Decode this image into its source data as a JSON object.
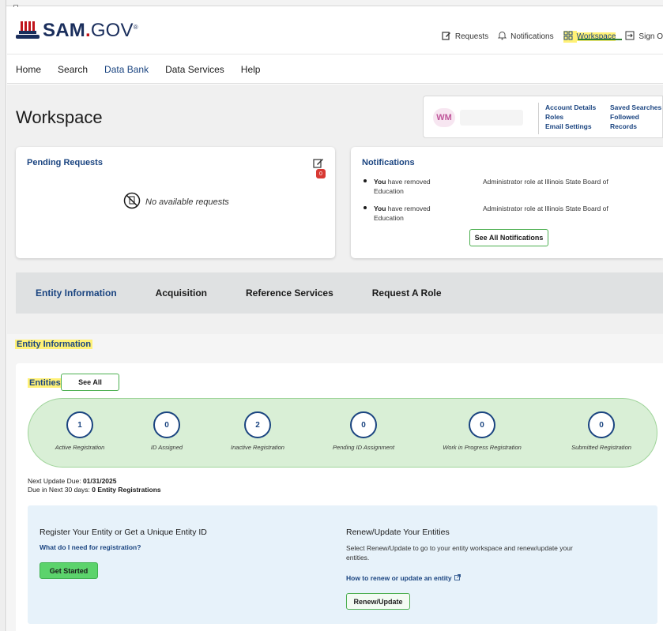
{
  "header": {
    "logo_main": "SAM",
    "logo_dot": ".",
    "logo_gov": "GOV",
    "logo_mark": "®",
    "utility": [
      {
        "label": "Requests",
        "icon": "edit-icon"
      },
      {
        "label": "Notifications",
        "icon": "bell-icon"
      },
      {
        "label": "Workspace",
        "icon": "grid-icon",
        "active": true
      },
      {
        "label": "Sign O",
        "icon": "sign-out-icon"
      }
    ]
  },
  "mainnav": {
    "items": [
      "Home",
      "Search",
      "Data Bank",
      "Data Services",
      "Help"
    ],
    "active_index": 2
  },
  "workspace": {
    "title": "Workspace",
    "profile": {
      "initials": "WM",
      "links_col1": [
        "Account Details",
        "Roles",
        "Email Settings"
      ],
      "links_col2": [
        "Saved Searches",
        "Followed Records"
      ]
    }
  },
  "pending": {
    "title": "Pending Requests",
    "badge": "0",
    "empty_text": "No available requests"
  },
  "notifications": {
    "title": "Notifications",
    "items": [
      {
        "actor": "You",
        "action": " have removed Education",
        "detail": "Administrator role at Illinois State Board of"
      },
      {
        "actor": "You",
        "action": " have removed Education",
        "detail": "Administrator role at Illinois State Board of"
      }
    ],
    "see_all": "See All Notifications"
  },
  "tabs": {
    "items": [
      "Entity Information",
      "Acquisition",
      "Reference Services",
      "Request A Role"
    ],
    "active_index": 0
  },
  "entity_section": {
    "title": "Entity Information",
    "entities_label": "Entities",
    "see_all": "See All",
    "stats": [
      {
        "value": "1",
        "label": "Active Registration"
      },
      {
        "value": "0",
        "label": "ID Assigned"
      },
      {
        "value": "2",
        "label": "Inactive Registration"
      },
      {
        "value": "0",
        "label": "Pending ID Assignment"
      },
      {
        "value": "0",
        "label": "Work in Progress Registration"
      },
      {
        "value": "0",
        "label": "Submitted Registration"
      }
    ],
    "next_update_label": "Next Update Due: ",
    "next_update_value": "01/31/2025",
    "due_label": "Due in Next 30 days: ",
    "due_value": "0 Entity Registrations"
  },
  "register": {
    "heading": "Register Your Entity or Get a Unique Entity ID",
    "link": "What do I need for registration?",
    "button": "Get Started"
  },
  "renew": {
    "heading": "Renew/Update Your Entities",
    "text": "Select Renew/Update to go to your entity workspace and renew/update your entities.",
    "link": "How to renew or update an entity",
    "button": "Renew/Update"
  },
  "colors": {
    "primary": "#1a4480",
    "highlight": "#fff176",
    "green": "#5cd36c",
    "pill": "#d9efd6",
    "badge": "#d83933"
  }
}
